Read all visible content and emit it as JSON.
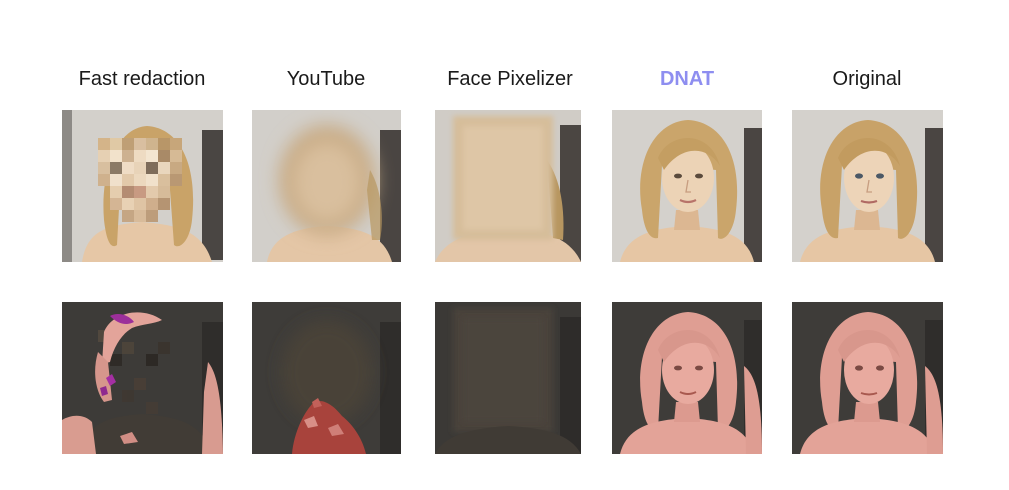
{
  "columns": [
    {
      "title": "Fast redaction"
    },
    {
      "title": "YouTube"
    },
    {
      "title": "Face Pixelizer"
    },
    {
      "title": "DNAT"
    },
    {
      "title": "Original"
    }
  ],
  "colors": {
    "highlight_title": "#8e8ef0",
    "segmentation_mask": "#e8a59a",
    "segmentation_background": "#3e3c39"
  },
  "rows": [
    {
      "kind": "anonymized-photo"
    },
    {
      "kind": "segmentation-overlay"
    }
  ]
}
